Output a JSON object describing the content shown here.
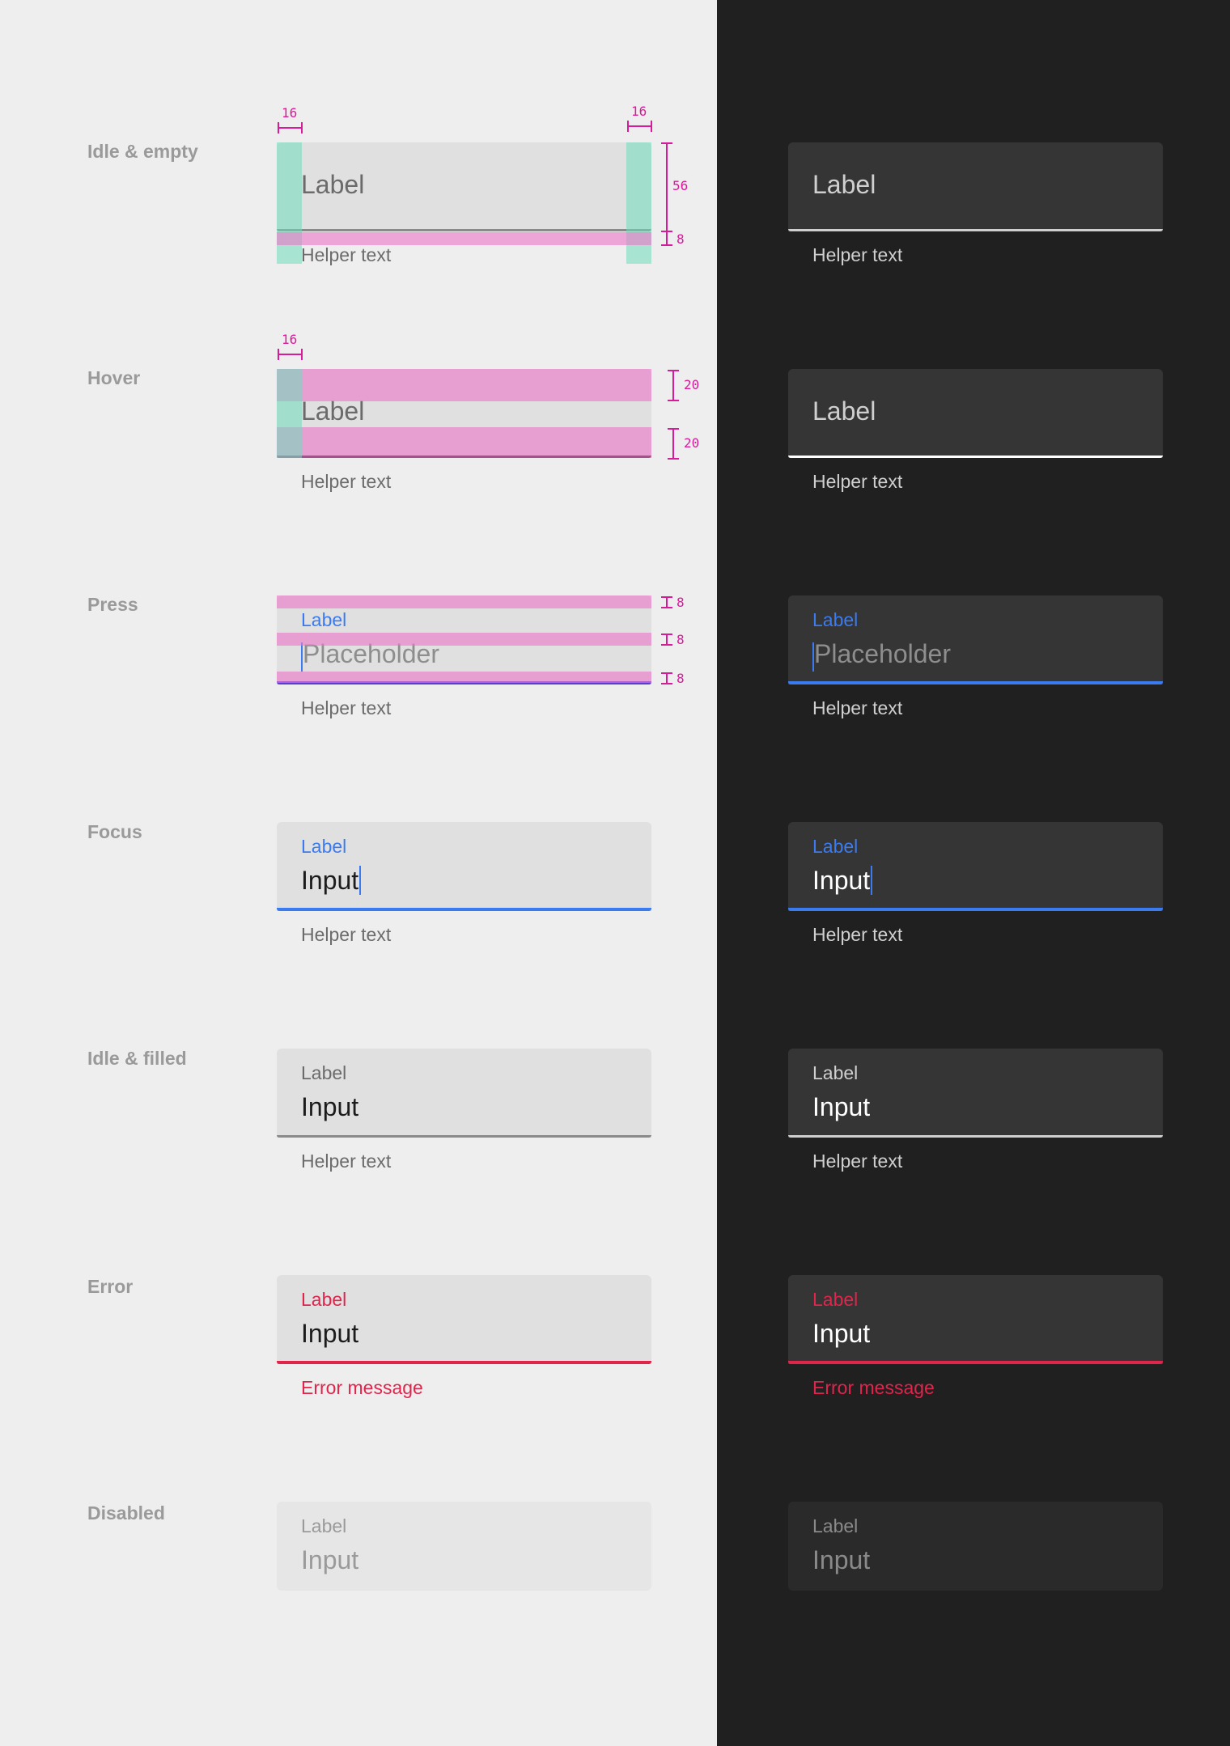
{
  "colors": {
    "light_bg": "#eeeeee",
    "dark_bg": "#202020",
    "field_light": "#e0e0e0",
    "field_dark": "#353535",
    "accent_blue": "#3a7bf0",
    "error_red": "#e0254c",
    "redline_magenta": "#d81b9a"
  },
  "states": [
    {
      "name": "Idle & empty"
    },
    {
      "name": "Hover"
    },
    {
      "name": "Press"
    },
    {
      "name": "Focus"
    },
    {
      "name": "Idle & filled"
    },
    {
      "name": "Error"
    },
    {
      "name": "Disabled"
    }
  ],
  "field": {
    "label": "Label",
    "placeholder": "Placeholder",
    "input": "Input",
    "helper": "Helper text",
    "error_message": "Error message"
  },
  "redlines": {
    "padding_left": "16",
    "padding_right": "16",
    "field_height": "56",
    "helper_gap": "8",
    "hover_padding_left": "16",
    "hover_top": "20",
    "hover_bottom": "20",
    "press_top": "8",
    "press_middle": "8",
    "press_bottom": "8"
  }
}
